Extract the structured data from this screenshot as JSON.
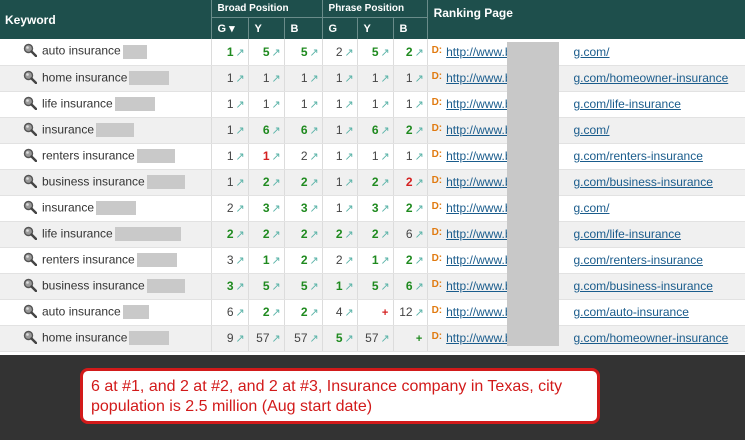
{
  "header": {
    "keyword": "Keyword",
    "broad": "Broad Position",
    "phrase": "Phrase Position",
    "ranking": "Ranking Page",
    "g_sort": "G ▾",
    "g": "G",
    "y": "Y",
    "b": "B"
  },
  "rows": [
    {
      "kw": "auto insurance",
      "bw": 24,
      "b": [
        [
          "1",
          "green",
          "↗"
        ],
        [
          "5",
          "green",
          "↗"
        ],
        [
          "5",
          "green",
          "↗"
        ]
      ],
      "p": [
        [
          "2",
          "gray",
          "↗"
        ],
        [
          "5",
          "green",
          "↗"
        ],
        [
          "2",
          "green",
          "↗"
        ]
      ],
      "url_a": "http://www.b",
      "url_b": "g.com/"
    },
    {
      "kw": "home insurance",
      "bw": 40,
      "b": [
        [
          "1",
          "gray",
          "↗"
        ],
        [
          "1",
          "gray",
          "↗"
        ],
        [
          "1",
          "gray",
          "↗"
        ]
      ],
      "p": [
        [
          "1",
          "gray",
          "↗"
        ],
        [
          "1",
          "gray",
          "↗"
        ],
        [
          "1",
          "gray",
          "↗"
        ]
      ],
      "url_a": "http://www.b",
      "url_b": "g.com/homeowner-insurance"
    },
    {
      "kw": "life insurance",
      "bw": 40,
      "b": [
        [
          "1",
          "gray",
          "↗"
        ],
        [
          "1",
          "gray",
          "↗"
        ],
        [
          "1",
          "gray",
          "↗"
        ]
      ],
      "p": [
        [
          "1",
          "gray",
          "↗"
        ],
        [
          "1",
          "gray",
          "↗"
        ],
        [
          "1",
          "gray",
          "↗"
        ]
      ],
      "url_a": "http://www.b",
      "url_b": "g.com/life-insurance"
    },
    {
      "kw": "insurance",
      "bw": 38,
      "b": [
        [
          "1",
          "gray",
          "↗"
        ],
        [
          "6",
          "green",
          "↗"
        ],
        [
          "6",
          "green",
          "↗"
        ]
      ],
      "p": [
        [
          "1",
          "gray",
          "↗"
        ],
        [
          "6",
          "green",
          "↗"
        ],
        [
          "2",
          "green",
          "↗"
        ]
      ],
      "url_a": "http://www.b",
      "url_b": "g.com/"
    },
    {
      "kw": "renters insurance",
      "bw": 38,
      "b": [
        [
          "1",
          "gray",
          "↗"
        ],
        [
          "1",
          "red",
          "↗"
        ],
        [
          "2",
          "gray",
          "↗"
        ]
      ],
      "p": [
        [
          "1",
          "gray",
          "↗"
        ],
        [
          "1",
          "gray",
          "↗"
        ],
        [
          "1",
          "gray",
          "↗"
        ]
      ],
      "url_a": "http://www.b",
      "url_b": "g.com/renters-insurance"
    },
    {
      "kw": "business insurance",
      "bw": 38,
      "b": [
        [
          "1",
          "gray",
          "↗"
        ],
        [
          "2",
          "green",
          "↗"
        ],
        [
          "2",
          "green",
          "↗"
        ]
      ],
      "p": [
        [
          "1",
          "gray",
          "↗"
        ],
        [
          "2",
          "green",
          "↗"
        ],
        [
          "2",
          "red",
          "↗"
        ]
      ],
      "url_a": "http://www.b",
      "url_b": "g.com/business-insurance"
    },
    {
      "kw": "insurance",
      "bw": 40,
      "b": [
        [
          "2",
          "gray",
          "↗"
        ],
        [
          "3",
          "green",
          "↗"
        ],
        [
          "3",
          "green",
          "↗"
        ]
      ],
      "p": [
        [
          "1",
          "gray",
          "↗"
        ],
        [
          "3",
          "green",
          "↗"
        ],
        [
          "2",
          "green",
          "↗"
        ]
      ],
      "url_a": "http://www.b",
      "url_b": "g.com/"
    },
    {
      "kw": "life insurance",
      "bw": 66,
      "b": [
        [
          "2",
          "green",
          "↗"
        ],
        [
          "2",
          "green",
          "↗"
        ],
        [
          "2",
          "green",
          "↗"
        ]
      ],
      "p": [
        [
          "2",
          "green",
          "↗"
        ],
        [
          "2",
          "green",
          "↗"
        ],
        [
          "6",
          "gray",
          "↗"
        ]
      ],
      "url_a": "http://www.b",
      "url_b": "g.com/life-insurance"
    },
    {
      "kw": "renters insurance",
      "bw": 40,
      "b": [
        [
          "3",
          "gray",
          "↗"
        ],
        [
          "1",
          "green",
          "↗"
        ],
        [
          "2",
          "green",
          "↗"
        ]
      ],
      "p": [
        [
          "2",
          "gray",
          "↗"
        ],
        [
          "1",
          "green",
          "↗"
        ],
        [
          "2",
          "green",
          "↗"
        ]
      ],
      "url_a": "http://www.b",
      "url_b": "g.com/renters-insurance"
    },
    {
      "kw": "business insurance",
      "bw": 38,
      "b": [
        [
          "3",
          "green",
          "↗"
        ],
        [
          "5",
          "green",
          "↗"
        ],
        [
          "5",
          "green",
          "↗"
        ]
      ],
      "p": [
        [
          "1",
          "green",
          "↗"
        ],
        [
          "5",
          "green",
          "↗"
        ],
        [
          "6",
          "green",
          "↗"
        ]
      ],
      "url_a": "http://www.b",
      "url_b": "g.com/business-insurance"
    },
    {
      "kw": "auto insurance",
      "bw": 26,
      "b": [
        [
          "6",
          "gray",
          "↗"
        ],
        [
          "2",
          "green",
          "↗"
        ],
        [
          "2",
          "green",
          "↗"
        ]
      ],
      "p": [
        [
          "4",
          "gray",
          "↗"
        ],
        [
          "",
          "red",
          "+"
        ],
        [
          "12",
          "gray",
          "↗"
        ]
      ],
      "url_a": "http://www.b",
      "url_b": "g.com/auto-insurance"
    },
    {
      "kw": "home insurance",
      "bw": 40,
      "b": [
        [
          "9",
          "gray",
          "↗"
        ],
        [
          "57",
          "gray",
          "↗"
        ],
        [
          "57",
          "gray",
          "↗"
        ]
      ],
      "p": [
        [
          "5",
          "green",
          "↗"
        ],
        [
          "57",
          "gray",
          "↗"
        ],
        [
          "",
          "green",
          "+"
        ]
      ],
      "url_a": "http://www.b",
      "url_b": "g.com/homeowner-insurance"
    }
  ],
  "note": "6 at #1, and 2 at #2, and 2 at #3, Insurance company in Texas, city population is 2.5 million (Aug start date)",
  "d_mark": "D:",
  "colors": {
    "header": "#1e4f4c",
    "green": "#1f8a1f",
    "red": "#d42020",
    "link": "#1a5c8c",
    "note": "#d21a1a"
  }
}
